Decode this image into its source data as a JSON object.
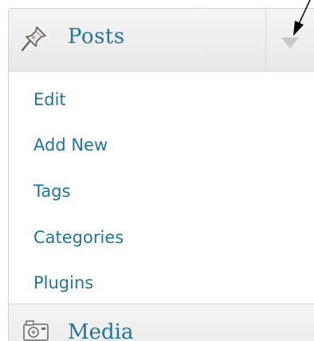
{
  "menu": {
    "header": {
      "label": "Posts",
      "icon": "pushpin-icon",
      "toggle_icon": "triangle-down-icon"
    },
    "items": [
      {
        "label": "Edit"
      },
      {
        "label": "Add New"
      },
      {
        "label": "Tags"
      },
      {
        "label": "Categories"
      },
      {
        "label": "Plugins"
      }
    ],
    "next_section": {
      "label": "Media",
      "icon": "camera-icon"
    }
  },
  "annotation": {
    "icon": "arrow-icon"
  },
  "colors": {
    "link": "#21759b",
    "toggle_arrow": "#c8c8c8",
    "header_bg": "#ececec",
    "border": "#d6d6d6"
  }
}
